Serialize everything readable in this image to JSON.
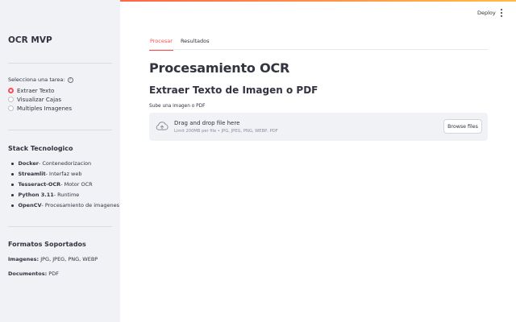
{
  "header": {
    "deploy_label": "Deploy"
  },
  "sidebar": {
    "app_title": "OCR MVP",
    "task_label": "Selecciona una tarea:",
    "help_glyph": "?",
    "task_options": [
      {
        "label": "Extraer Texto",
        "selected": true
      },
      {
        "label": "Visualizar Cajas",
        "selected": false
      },
      {
        "label": "Multiples Imagenes",
        "selected": false
      }
    ],
    "stack_title": "Stack Tecnologico",
    "stack_items": [
      {
        "name": "Docker",
        "desc": " - Contenedorizacion"
      },
      {
        "name": "Streamlit",
        "desc": " - Interfaz web"
      },
      {
        "name": "Tesseract-OCR",
        "desc": " - Motor OCR"
      },
      {
        "name": "Python 3.11",
        "desc": " - Runtime"
      },
      {
        "name": "OpenCV",
        "desc": " - Procesamiento de imagenes"
      }
    ],
    "formats_title": "Formatos Soportados",
    "images_label": "Imagenes:",
    "images_value": " JPG, JPEG, PNG, WEBP",
    "docs_label": "Documentos:",
    "docs_value": " PDF"
  },
  "main": {
    "tabs": [
      {
        "label": "Procesar",
        "active": true
      },
      {
        "label": "Resultados",
        "active": false
      }
    ],
    "title": "Procesamiento OCR",
    "subtitle": "Extraer Texto de Imagen o PDF",
    "upload_label": "Sube una imagen o PDF",
    "dropzone": {
      "title": "Drag and drop file here",
      "limits": "Limit 200MB per file • JPG, JPEG, PNG, WEBP, PDF",
      "browse_label": "Browse files"
    }
  },
  "colors": {
    "accent": "#ff4b4b",
    "sidebar_bg": "#f0f2f6",
    "text": "#31333f"
  }
}
